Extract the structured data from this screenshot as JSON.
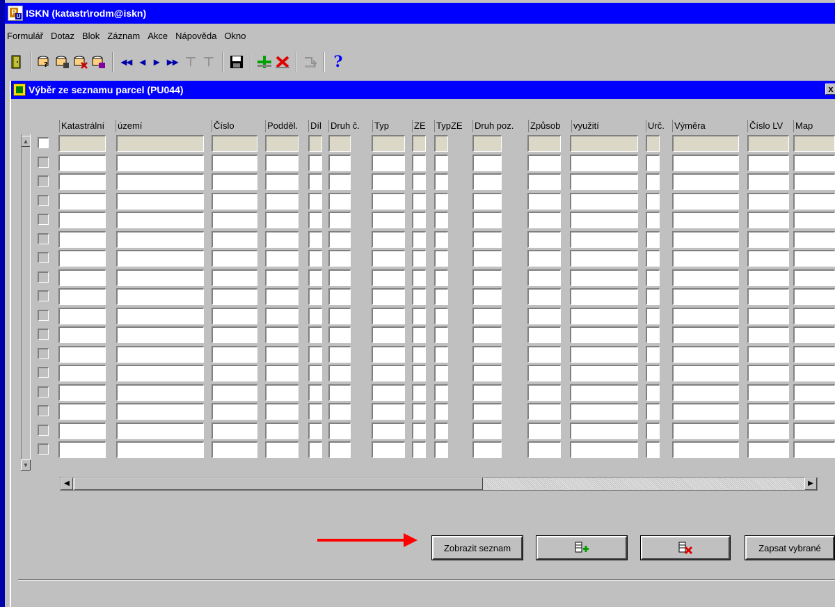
{
  "app": {
    "title": "ISKN (katastr\\rodm@iskn)",
    "menu": [
      "Formulář",
      "Dotaz",
      "Blok",
      "Záznam",
      "Akce",
      "Nápověda",
      "Okno"
    ]
  },
  "toolbar": {
    "icons": [
      "exit-icon",
      "query-enter-icon",
      "query-execute-icon",
      "query-cancel-icon",
      "query-count-icon",
      "first-block-icon",
      "prev-record-icon",
      "next-record-icon",
      "last-block-icon",
      "prev-block-disabled-icon",
      "next-block-disabled-icon",
      "save-icon",
      "insert-record-icon",
      "delete-record-icon",
      "commit-disabled-icon",
      "help-icon"
    ],
    "help_label": "?"
  },
  "form": {
    "title": "Výběr ze seznamu parcel (PU044)",
    "close_label": "x"
  },
  "grid": {
    "columns": [
      {
        "label": "Katastrální"
      },
      {
        "label": "území"
      },
      {
        "label": "Číslo"
      },
      {
        "label": "Podděl."
      },
      {
        "label": "Díl"
      },
      {
        "label": "Druh č."
      },
      {
        "label": "Typ"
      },
      {
        "label": "ZE"
      },
      {
        "label": "TypZE"
      },
      {
        "label": "Druh poz."
      },
      {
        "label": "Způsob"
      },
      {
        "label": "využití"
      },
      {
        "label": "Urč."
      },
      {
        "label": "Výměra"
      },
      {
        "label": "Číslo LV"
      },
      {
        "label": "Map"
      }
    ],
    "row_count": 17
  },
  "buttons": {
    "show_list": "Zobrazit seznam",
    "add_icon": "add-row-icon",
    "remove_icon": "remove-row-icon",
    "write_selected": "Zapsat vybrané"
  },
  "annotation": {
    "arrow_color": "#ff0000"
  }
}
